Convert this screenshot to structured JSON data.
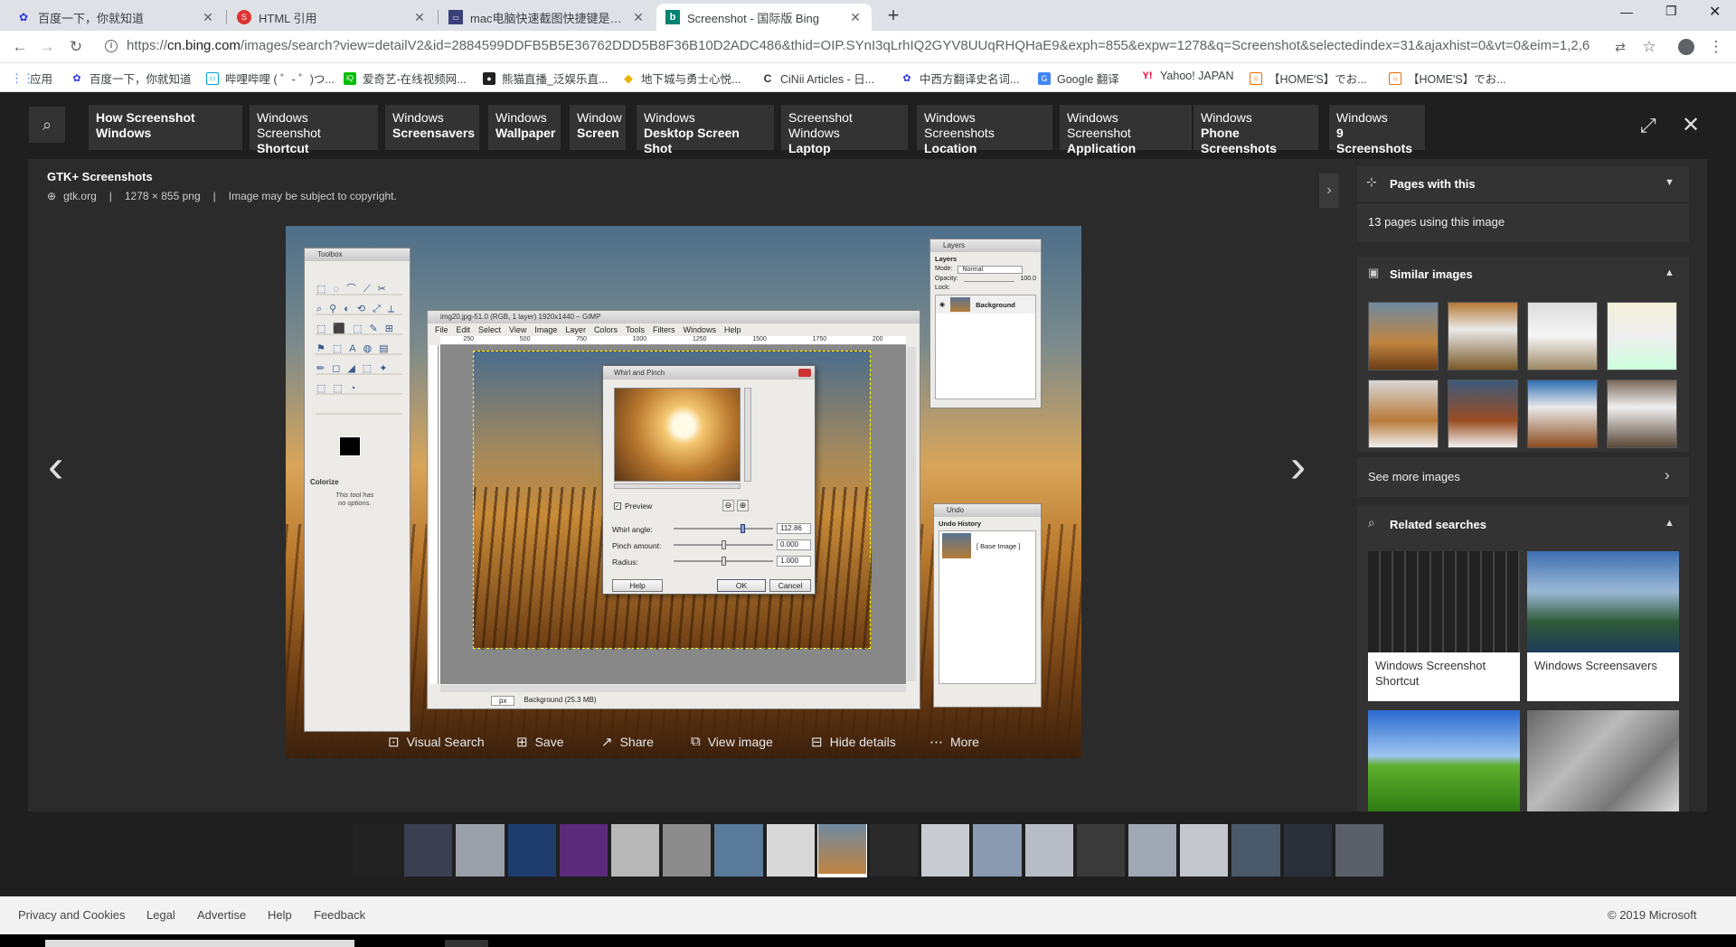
{
  "browser": {
    "tabs": [
      {
        "title": "百度一下，你就知道",
        "icon": "baidu-paw-icon"
      },
      {
        "title": "HTML 引用",
        "icon": "html-tutorial-icon"
      },
      {
        "title": "mac电脑快速截图快捷键是什么?",
        "icon": "monitor-icon"
      },
      {
        "title": "Screenshot - 国际版 Bing",
        "icon": "bing-icon"
      }
    ],
    "new_tab": "+",
    "url_prefix": "https://",
    "url_host": "cn.bing.com",
    "url_path": "/images/search?view=detailV2&id=2884599DDFB5B5E36762DDD5B8F36B10D2ADC486&thid=OIP.SYnI3qLrhIQ2GYV8UUqRHQHaE9&exph=855&expw=1278&q=Screenshot&selectedindex=31&ajaxhist=0&vt=0&eim=1,2,6",
    "bookmarks": [
      {
        "label": "应用",
        "icon": "apps-grid-icon",
        "color": "#4285f4"
      },
      {
        "label": "百度一下，你就知道",
        "icon": "baidu-paw-icon",
        "color": "#2932e1"
      },
      {
        "label": "哔哩哔哩 ( ゜- ゜)つ...",
        "icon": "bilibili-icon",
        "color": "#00a1d6"
      },
      {
        "label": "爱奇艺-在线视频网...",
        "icon": "iqiyi-icon",
        "color": "#00be06"
      },
      {
        "label": "熊猫直播_泛娱乐直...",
        "icon": "panda-icon",
        "color": "#222"
      },
      {
        "label": "地下城与勇士心悦...",
        "icon": "diamond-icon",
        "color": "#e8b400"
      },
      {
        "label": "CiNii Articles - 日...",
        "icon": "cinii-icon",
        "color": "#333"
      },
      {
        "label": "中西方翻译史名词...",
        "icon": "baidu-paw-icon",
        "color": "#2932e1"
      },
      {
        "label": "Google 翻译",
        "icon": "google-translate-icon",
        "color": "#4285f4"
      },
      {
        "label": "Yahoo! JAPAN",
        "icon": "yahoo-icon",
        "color": "#ff0033"
      },
      {
        "label": "【HOME'S】でお...",
        "icon": "homes-icon",
        "color": "#ed6d00"
      },
      {
        "label": "【HOME'S】でお...",
        "icon": "homes-icon",
        "color": "#ed6d00"
      }
    ]
  },
  "related_top": [
    {
      "line1": "How Screenshot Windows",
      "line2": ""
    },
    {
      "line1": "Windows Screenshot",
      "line2": "Shortcut"
    },
    {
      "line1": "Windows",
      "line2": "Screensavers"
    },
    {
      "line1": "Windows",
      "line2": "Wallpaper"
    },
    {
      "line1": "Window",
      "line2": "Screen"
    },
    {
      "line1": "Windows",
      "line2": "Desktop Screen Shot"
    },
    {
      "line1": "Screenshot Windows",
      "line2": "Laptop"
    },
    {
      "line1": "Windows Screenshots",
      "line2": "Location"
    },
    {
      "line1": "Windows Screenshot",
      "line2": "Application"
    },
    {
      "line1": "Windows",
      "line2": "Phone Screenshots"
    },
    {
      "line1": "Windows",
      "line2": "9 Screenshots"
    }
  ],
  "detail": {
    "title": "GTK+ Screenshots",
    "source": "gtk.org",
    "dims": "1278 × 855 png",
    "copyright": "Image may be subject to copyright."
  },
  "gimp": {
    "toolbox_title": "Toolbox",
    "colorize": "Colorize",
    "colorize_note_1": "This tool has",
    "colorize_note_2": "no options.",
    "image_title": "img20.jpg-51.0 (RGB, 1 layer) 1920x1440 – GIMP",
    "menus": [
      "File",
      "Edit",
      "Select",
      "View",
      "Image",
      "Layer",
      "Colors",
      "Tools",
      "Filters",
      "Windows",
      "Help"
    ],
    "ruler": [
      "250",
      "500",
      "750",
      "1000",
      "1250",
      "1500",
      "1750",
      "200"
    ],
    "status_unit": "px",
    "status_text": "Background (25.3 MB)",
    "dialog_title": "Whirl and Pinch",
    "preview": "Preview",
    "whirl_label": "Whirl angle:",
    "whirl_value": "112.86",
    "pinch_label": "Pinch amount:",
    "pinch_value": "0.000",
    "radius_label": "Radius:",
    "radius_value": "1.000",
    "help": "Help",
    "ok": "OK",
    "cancel": "Cancel",
    "layers_title": "Layers",
    "layers_tab": "Layers",
    "mode_label": "Mode:",
    "mode_value": "Normal",
    "opacity_label": "Opacity:",
    "opacity_value": "100.0",
    "lock_label": "Lock:",
    "layer_name": "Background",
    "undo_title": "Undo",
    "undo_history": "Undo History",
    "undo_item": "[ Base Image ]"
  },
  "actions": {
    "visual_search": "Visual Search",
    "save": "Save",
    "share": "Share",
    "view_image": "View image",
    "hide_details": "Hide details",
    "more": "More"
  },
  "side": {
    "pages_with_this": "Pages with this",
    "pages_count": "13 pages using this image",
    "similar_images": "Similar images",
    "see_more": "See more images",
    "related_searches": "Related searches",
    "related_cards": [
      "Windows Screenshot Shortcut",
      "Windows Screensavers"
    ]
  },
  "footer": {
    "links": [
      "Privacy and Cookies",
      "Legal",
      "Advertise",
      "Help",
      "Feedback"
    ],
    "copyright": "© 2019 Microsoft"
  }
}
